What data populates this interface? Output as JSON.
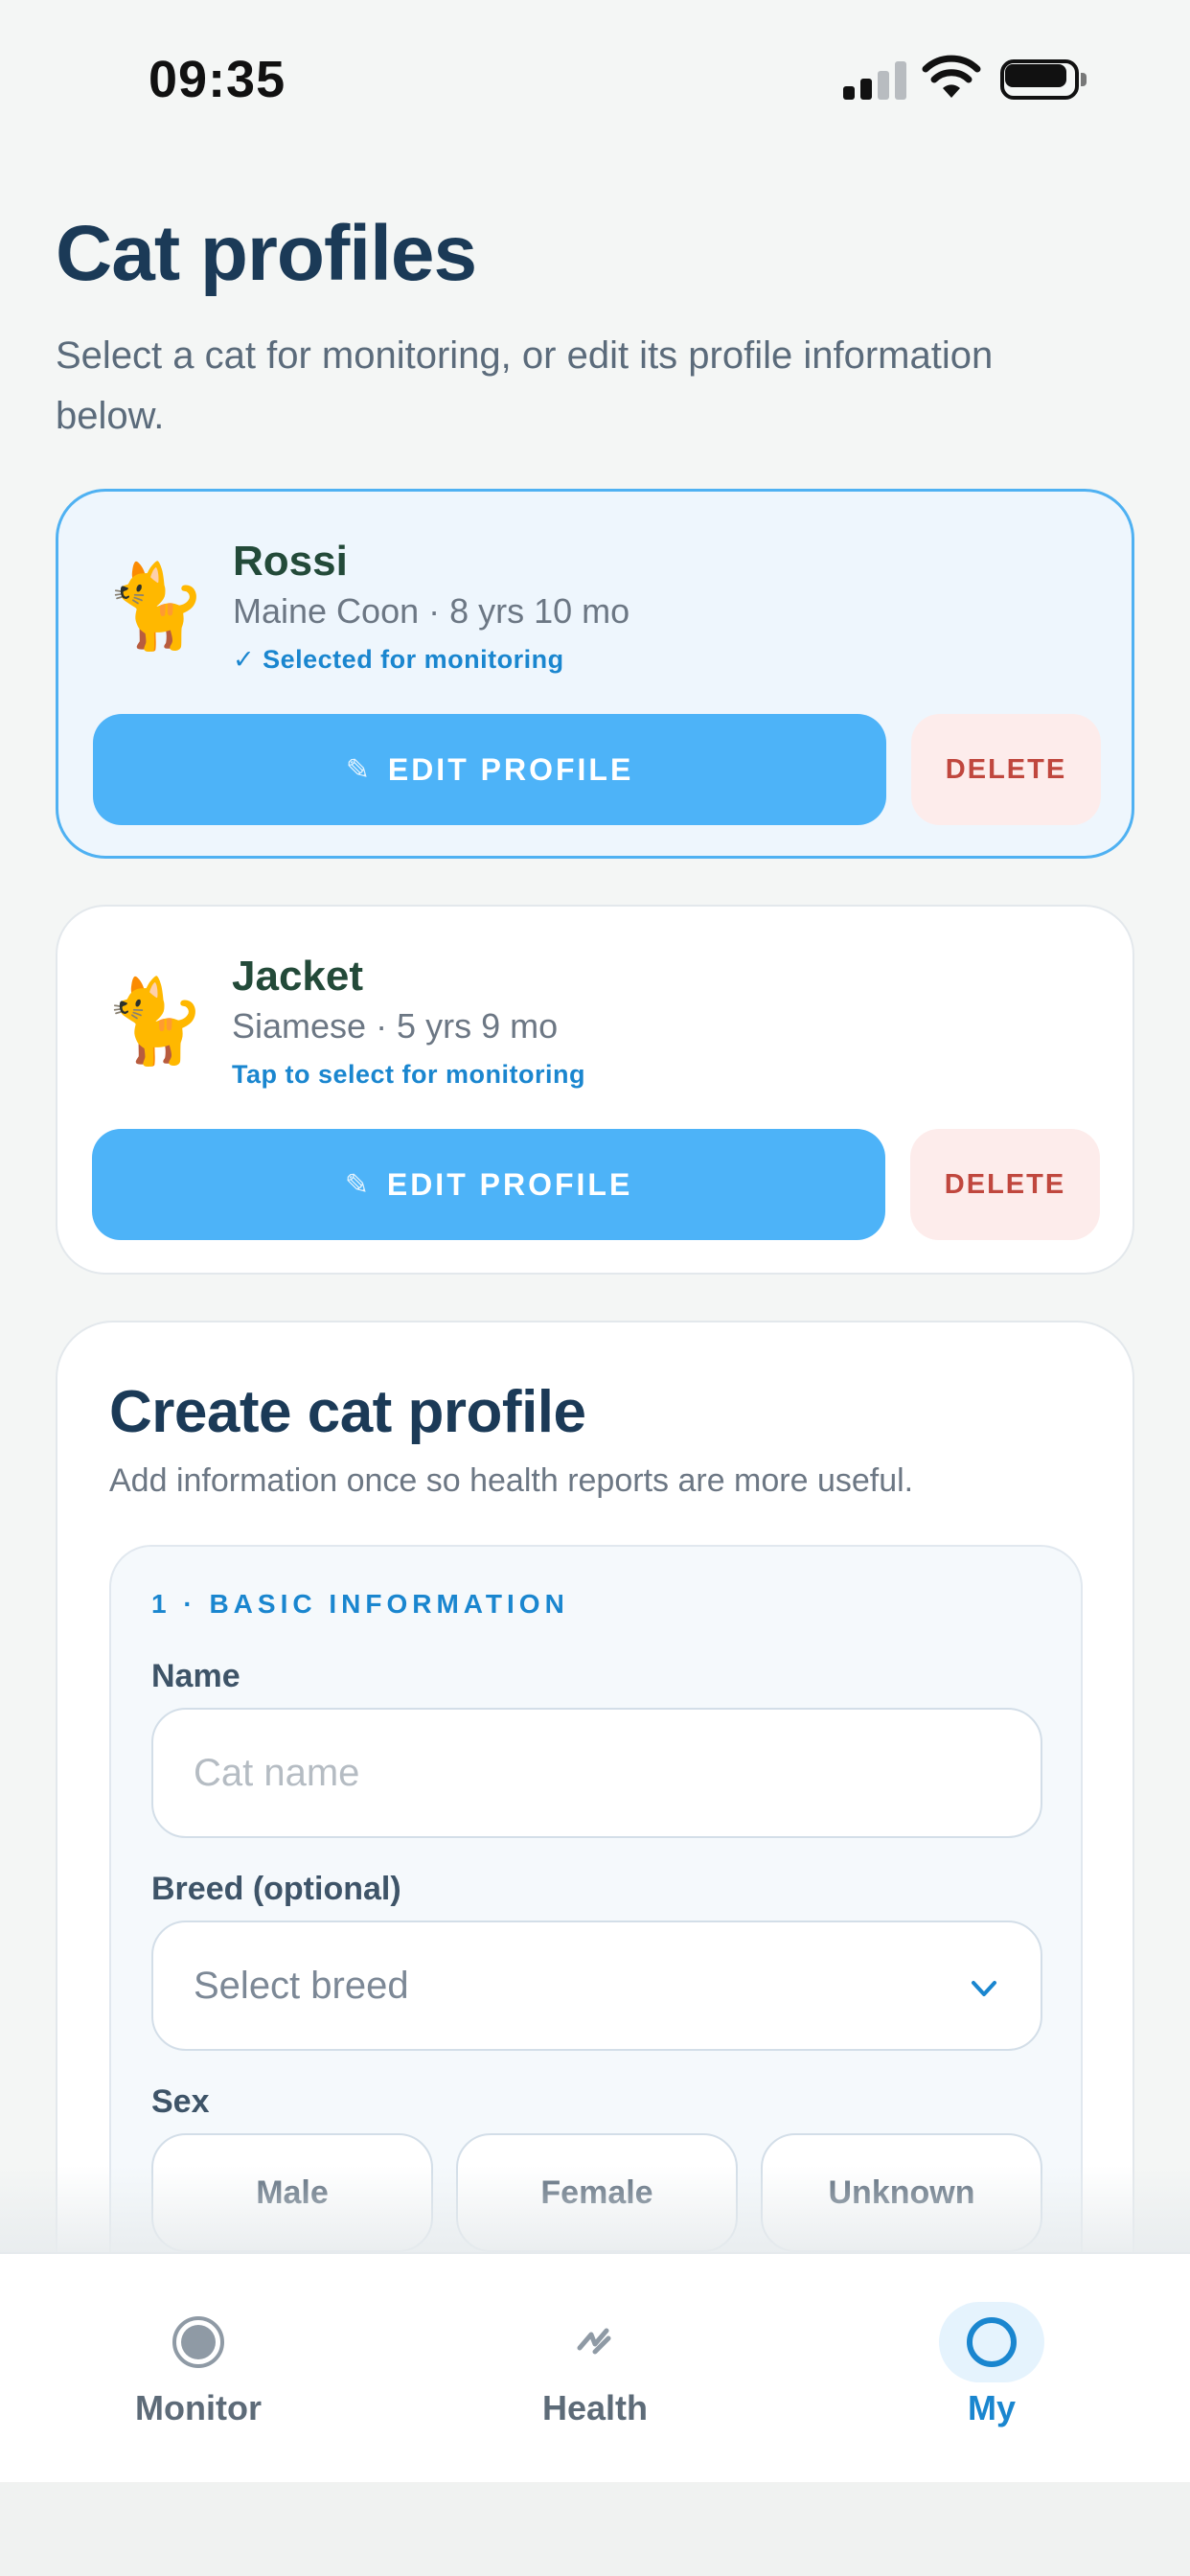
{
  "status_bar": {
    "time": "09:35"
  },
  "header": {
    "title": "Cat profiles",
    "subtitle": "Select a cat for monitoring, or edit its profile information below."
  },
  "cats": [
    {
      "name": "Rossi",
      "meta": "Maine Coon · 8 yrs 10 mo",
      "status": "✓ Selected for monitoring",
      "selected": true,
      "edit_label": "EDIT PROFILE",
      "delete_label": "DELETE",
      "avatar": "🐈"
    },
    {
      "name": "Jacket",
      "meta": "Siamese · 5 yrs 9 mo",
      "status": "Tap to select for monitoring",
      "selected": false,
      "edit_label": "EDIT PROFILE",
      "delete_label": "DELETE",
      "avatar": "🐈"
    }
  ],
  "create": {
    "title": "Create cat profile",
    "subtitle": "Add information once so health reports are more useful.",
    "section_label": "1 · BASIC INFORMATION",
    "name_label": "Name",
    "name_placeholder": "Cat name",
    "breed_label": "Breed (optional)",
    "breed_placeholder": "Select breed",
    "sex_label": "Sex",
    "sex_options": [
      "Male",
      "Female",
      "Unknown"
    ]
  },
  "nav": {
    "items": [
      {
        "label": "Monitor",
        "icon": "record-icon",
        "active": false
      },
      {
        "label": "Health",
        "icon": "pulse-icon",
        "active": false
      },
      {
        "label": "My",
        "icon": "ring-icon",
        "active": true
      }
    ]
  },
  "colors": {
    "accent": "#4db3f8",
    "accent_text": "#1a86cf",
    "title": "#1b3a57",
    "delete_bg": "#fdeceb",
    "delete_text": "#c0473e",
    "selected_border": "#4fb1f2"
  }
}
